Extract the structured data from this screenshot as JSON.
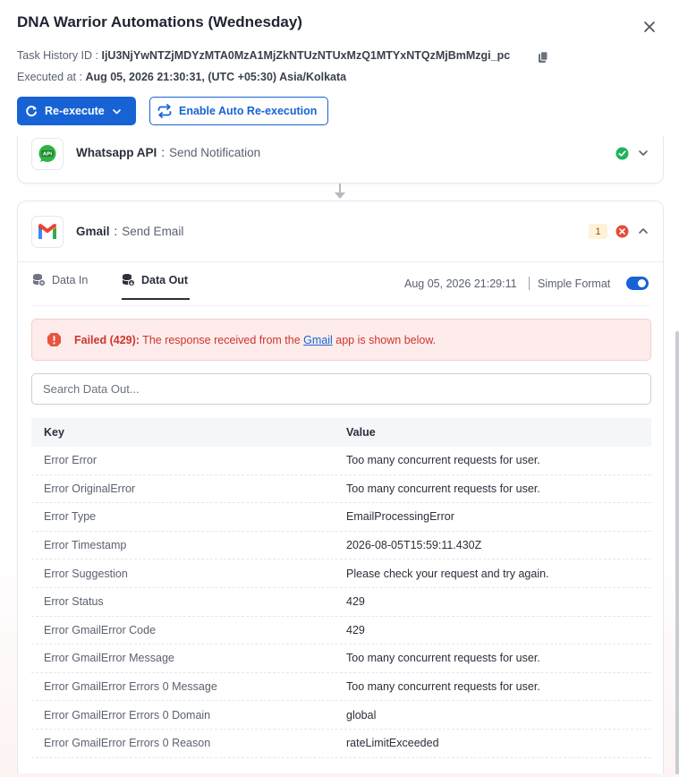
{
  "header": {
    "title": "DNA Warrior Automations (Wednesday)",
    "task_history_label": "Task History ID : ",
    "task_history_id": "IjU3NjYwNTZjMDYzMTA0MzA1MjZkNTUzNTUxMzQ1MTYxNTQzMjBmMzgi_pc",
    "executed_label": "Executed at : ",
    "executed_value": "Aug 05, 2026 21:30:31, (UTC +05:30) Asia/Kolkata",
    "reexecute_label": "Re-execute",
    "auto_reexecute_label": "Enable Auto Re-execution"
  },
  "steps": [
    {
      "app": "Whatsapp API",
      "separator": ":",
      "action": "Send Notification",
      "status": "success"
    },
    {
      "app": "Gmail",
      "separator": ":",
      "action": "Send Email",
      "badge": "1",
      "status": "error"
    }
  ],
  "tabs": {
    "data_in": "Data In",
    "data_out": "Data Out",
    "active": "Data Out"
  },
  "exec_time": "Aug 05, 2026 21:29:11",
  "format_label": "Simple Format",
  "simple_format_on": true,
  "alert": {
    "prefix": "Failed (429):",
    "text_before": " The response received from the ",
    "link": "Gmail",
    "text_after": " app is shown below."
  },
  "search": {
    "placeholder": "Search Data Out..."
  },
  "table": {
    "headers": {
      "key": "Key",
      "value": "Value"
    },
    "rows": [
      {
        "key": "Error Error",
        "value": "Too many concurrent requests for user."
      },
      {
        "key": "Error OriginalError",
        "value": "Too many concurrent requests for user."
      },
      {
        "key": "Error Type",
        "value": "EmailProcessingError"
      },
      {
        "key": "Error Timestamp",
        "value": "2026-08-05T15:59:11.430Z"
      },
      {
        "key": "Error Suggestion",
        "value": "Please check your request and try again."
      },
      {
        "key": "Error Status",
        "value": "429"
      },
      {
        "key": "Error GmailError Code",
        "value": "429"
      },
      {
        "key": "Error GmailError Message",
        "value": "Too many concurrent requests for user."
      },
      {
        "key": "Error GmailError Errors 0 Message",
        "value": "Too many concurrent requests for user."
      },
      {
        "key": "Error GmailError Errors 0 Domain",
        "value": "global"
      },
      {
        "key": "Error GmailError Errors 0 Reason",
        "value": "rateLimitExceeded"
      }
    ]
  },
  "colors": {
    "primary": "#1763d6",
    "success": "#1fb35c",
    "error": "#e64a3a",
    "alert_bg": "#fdeceb",
    "alert_text": "#d0342c"
  }
}
